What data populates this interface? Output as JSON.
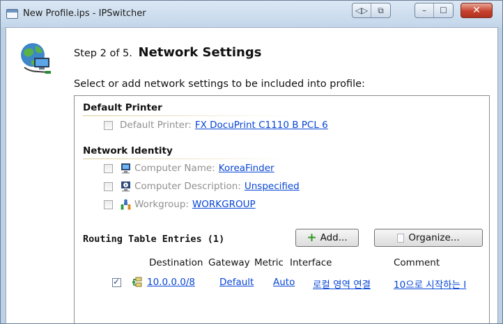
{
  "window": {
    "title": "New Profile.ips - IPSwitcher",
    "controls": [
      "back-forward",
      "restore",
      "minimize",
      "maximize",
      "close"
    ]
  },
  "wizard": {
    "step_prefix": "Step 2 of 5.",
    "step_title": "Network Settings",
    "instruction": "Select or add network settings to be included into profile:"
  },
  "default_printer": {
    "heading": "Default Printer",
    "label": "Default Printer:",
    "value": "FX DocuPrint C1110 B PCL 6",
    "checked": false
  },
  "network_identity": {
    "heading": "Network Identity",
    "items": [
      {
        "label": "Computer Name:",
        "value": "KoreaFinder",
        "icon": "computer-icon",
        "checked": false
      },
      {
        "label": "Computer Description:",
        "value": "Unspecified",
        "icon": "info-monitor-icon",
        "checked": false
      },
      {
        "label": "Workgroup:",
        "value": "WORKGROUP",
        "icon": "workgroup-icon",
        "checked": false
      }
    ]
  },
  "routing": {
    "heading": "Routing Table Entries (1)",
    "add_label": "Add...",
    "organize_label": "Organize...",
    "columns": [
      "Destination",
      "Gateway",
      "Metric",
      "Interface",
      "Comment"
    ],
    "rows": [
      {
        "destination": "10.0.0.0/8",
        "gateway": "Default",
        "metric": "Auto",
        "interface": "로컬 영역 연결",
        "comment": "10으로 시작하는 I",
        "checked": true
      }
    ]
  },
  "colors": {
    "link": "#0645d6",
    "close_button": "#c6422d",
    "window_frame": "#bcd0e6"
  }
}
